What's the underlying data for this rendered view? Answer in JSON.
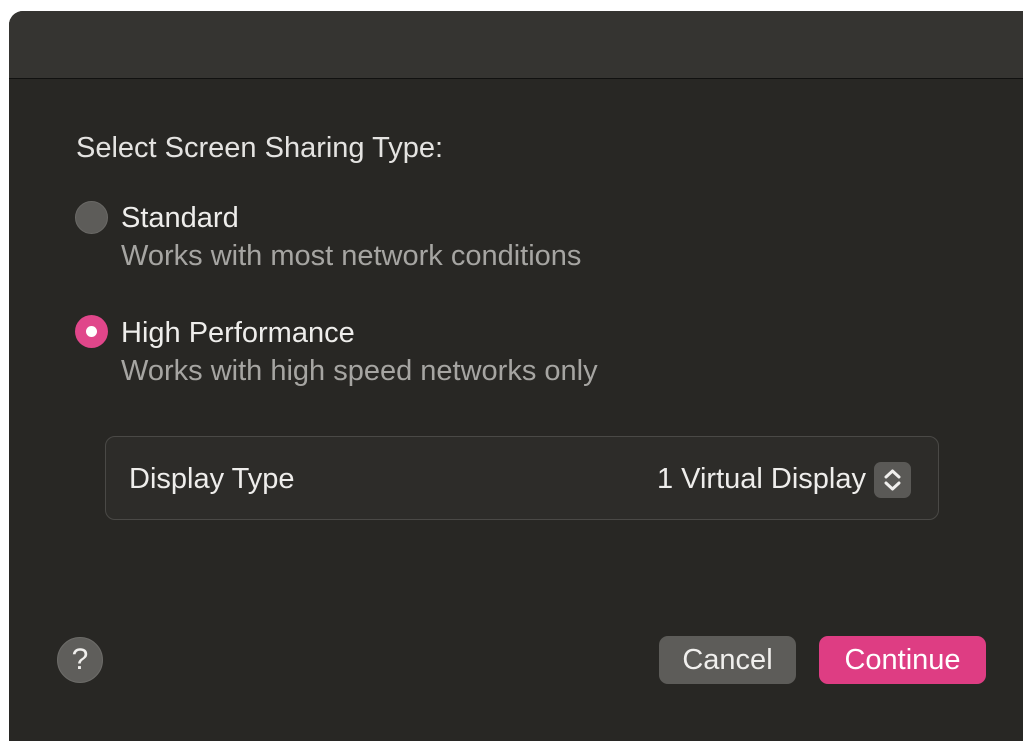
{
  "dialog": {
    "heading": "Select Screen Sharing Type:",
    "options": [
      {
        "label": "Standard",
        "description": "Works with most network conditions",
        "selected": false
      },
      {
        "label": "High Performance",
        "description": "Works with high speed networks only",
        "selected": true
      }
    ],
    "display_type": {
      "label": "Display Type",
      "value": "1 Virtual Display",
      "icon": "chevron-up-down-icon"
    },
    "help_icon": "?",
    "buttons": {
      "cancel": "Cancel",
      "continue": "Continue"
    }
  },
  "colors": {
    "accent": "#de3d83",
    "background": "#282724",
    "titlebar": "#353431"
  }
}
